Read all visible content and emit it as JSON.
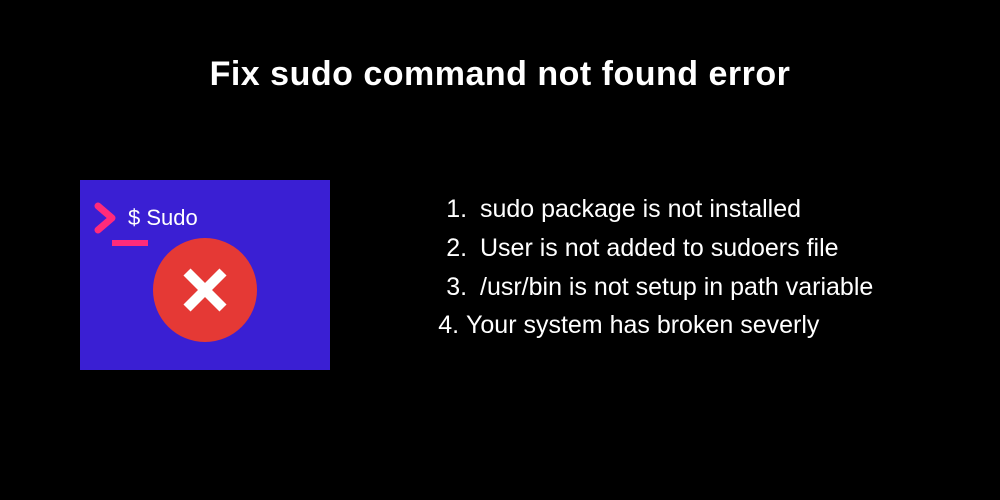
{
  "title": "Fix sudo command not found error",
  "terminal": {
    "prompt": "$ Sudo"
  },
  "reasons": [
    "sudo package is not installed",
    "User is not added to sudoers file",
    "/usr/bin is not setup in path variable",
    "Your system has broken severly"
  ],
  "colors": {
    "accent_pink": "#ff2b7a",
    "terminal_bg": "#3a1fd3",
    "error_red": "#e53935"
  }
}
